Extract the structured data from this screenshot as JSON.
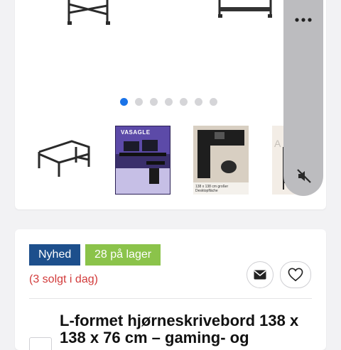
{
  "gallery": {
    "slide_count": 7,
    "active_slide": 1,
    "thumbnails": [
      {
        "name": "thumb-desk-l-shape"
      },
      {
        "name": "thumb-gaming-setup",
        "label": "VASAGLE"
      },
      {
        "name": "thumb-top-view",
        "caption": "138 x 138 cm großer Desktopfläche"
      },
      {
        "name": "thumb-partial"
      }
    ],
    "menu_icon": "more-horizontal-icon",
    "mute_icon": "volume-mute-icon"
  },
  "product": {
    "badge_new": "Nyhed",
    "badge_stock": "28 på lager",
    "sold_today": "(3 solgt i dag)",
    "title": "L-formet hjørneskrivebord 138 x 138 x 76 cm – gaming- og",
    "mail_icon": "envelope-icon",
    "heart_icon": "heart-icon"
  },
  "colors": {
    "accent_blue": "#1a73e8",
    "badge_new": "#1d4f8c",
    "badge_stock": "#8bc34a",
    "sold_red": "#d23b3b"
  }
}
